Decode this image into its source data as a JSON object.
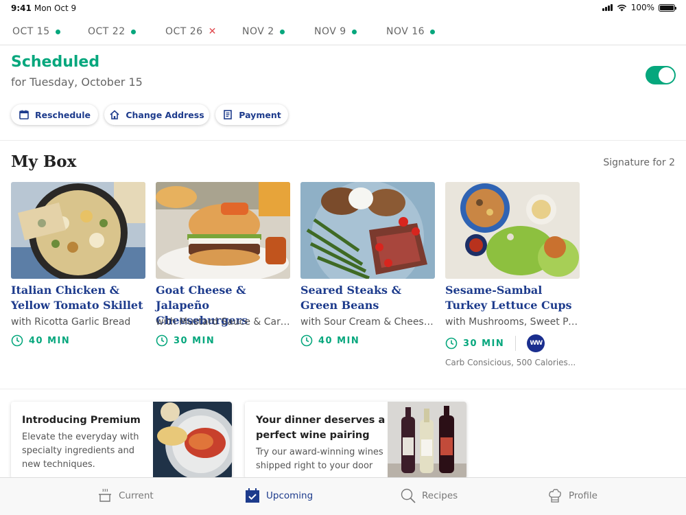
{
  "status_bar": {
    "time": "9:41",
    "date": "Mon Oct 9",
    "battery": "100%",
    "battery_level": 1.0
  },
  "date_tabs": [
    {
      "label": "OCT 15",
      "status": "scheduled",
      "active": true
    },
    {
      "label": "OCT 22",
      "status": "scheduled",
      "active": false
    },
    {
      "label": "OCT 26",
      "status": "skipped",
      "active": false
    },
    {
      "label": "NOV 2",
      "status": "scheduled",
      "active": false
    },
    {
      "label": "NOV 9",
      "status": "scheduled",
      "active": false
    },
    {
      "label": "NOV 16",
      "status": "scheduled",
      "active": false
    }
  ],
  "schedule": {
    "title": "Scheduled",
    "subtitle": "for Tuesday, October 15",
    "toggle_on": true
  },
  "actions": {
    "reschedule": {
      "label": "Reschedule",
      "icon": "calendar-icon"
    },
    "change_address": {
      "label": "Change Address",
      "icon": "home-icon"
    },
    "payment": {
      "label": "Payment",
      "icon": "receipt-icon"
    }
  },
  "my_box": {
    "title": "My Box",
    "plan": "Signature for 2",
    "recipes": [
      {
        "title": "Italian Chicken & Yellow Tomato Skillet",
        "subtitle": "with Ricotta Garlic Bread",
        "time": "40 MIN"
      },
      {
        "title": "Goat Cheese & Jalapeño Cheeseburgers",
        "subtitle": "with Mustard Sauce & Carrot",
        "time": "30 MIN"
      },
      {
        "title": "Seared Steaks & Green Beans",
        "subtitle": "with Sour Cream & Cheesy...",
        "time": "40 MIN"
      },
      {
        "title": "Sesame-Sambal Turkey Lettuce Cups",
        "subtitle": "with Mushrooms, Sweet Pe...",
        "time": "30 MIN",
        "badge": "WW",
        "note": "Carb Consicious, 500 Calories..."
      }
    ]
  },
  "promos": [
    {
      "title": "Introducing Premium",
      "body": "Elevate the everyday with specialty ingredients and new techniques."
    },
    {
      "title": "Your dinner deserves a perfect wine pairing",
      "body": "Try our award-winning wines shipped right to your door"
    }
  ],
  "tab_bar": {
    "current": {
      "label": "Current",
      "icon": "pot-icon"
    },
    "upcoming": {
      "label": "Upcoming",
      "icon": "calendar-check-icon"
    },
    "recipes": {
      "label": "Recipes",
      "icon": "search-icon"
    },
    "profile": {
      "label": "Profile",
      "icon": "chef-hat-icon"
    }
  },
  "colors": {
    "accent": "#06a77d",
    "brand_blue": "#1d3b8c",
    "skip_red": "#e0464b"
  }
}
